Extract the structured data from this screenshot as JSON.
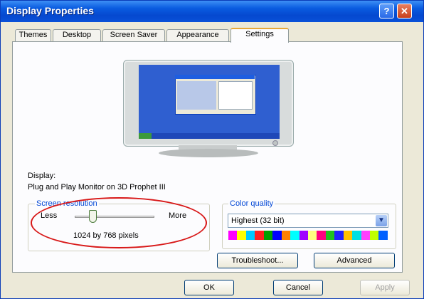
{
  "window": {
    "title": "Display Properties",
    "help_glyph": "?",
    "close_glyph": "✕"
  },
  "tabs": [
    {
      "label": "Themes",
      "active": false
    },
    {
      "label": "Desktop",
      "active": false
    },
    {
      "label": "Screen Saver",
      "active": false
    },
    {
      "label": "Appearance",
      "active": false
    },
    {
      "label": "Settings",
      "active": true
    }
  ],
  "display": {
    "label": "Display:",
    "value": "Plug and Play Monitor on 3D Prophet III"
  },
  "screen_resolution": {
    "title": "Screen resolution",
    "less_label": "Less",
    "more_label": "More",
    "value": "1024 by 768 pixels",
    "slider_position": 0.2
  },
  "color_quality": {
    "title": "Color quality",
    "selected": "Highest (32 bit)",
    "arrow_glyph": "▼",
    "palette": [
      "#ff00ff",
      "#ffff00",
      "#00c8ff",
      "#ff2020",
      "#00a000",
      "#0000ff",
      "#ff8000",
      "#00ffff",
      "#a000ff",
      "#ffff80",
      "#ff0080",
      "#20c020",
      "#2020ff",
      "#ffc000",
      "#00e0e0",
      "#ff40ff",
      "#c0ff00",
      "#0060ff"
    ]
  },
  "buttons": {
    "troubleshoot": "Troubleshoot...",
    "advanced": "Advanced",
    "ok": "OK",
    "cancel": "Cancel",
    "apply": "Apply"
  },
  "colors": {
    "titlebar": "#0548cf",
    "annotation": "#d81818"
  }
}
